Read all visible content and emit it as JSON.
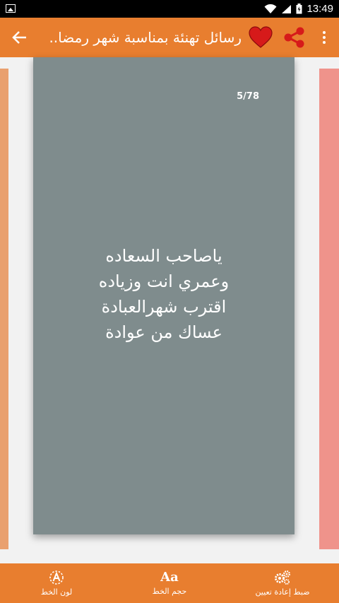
{
  "status_bar": {
    "time": "13:49",
    "icons": [
      "image-icon",
      "wifi-icon",
      "signal-icon",
      "battery-icon"
    ]
  },
  "app_bar": {
    "title": "رسائل تهنئة بمناسبة شهر رمضا...",
    "icons": [
      "more-vert-icon",
      "share-icon",
      "heart-icon",
      "back-arrow-icon"
    ]
  },
  "card": {
    "counter": "5/78",
    "lines": [
      "ياصاحب السعاده",
      "وعمري انت وزياده",
      "اقترب شهرالعبادة",
      "عساك من عوادة"
    ]
  },
  "bottom_bar": {
    "items": [
      {
        "icon": "font-color-icon",
        "label": "لون الخط"
      },
      {
        "icon": "font-size-icon",
        "glyph": "Aa",
        "label": "حجم الخط"
      },
      {
        "icon": "settings-gears-icon",
        "label": "ضبط إعادة تعيين"
      }
    ]
  },
  "colors": {
    "app_bar": "#e87e2f",
    "card": "#7f8c8d",
    "side_left": "#e9a06f",
    "side_right": "#ef938b",
    "heart": "#d61a1a"
  }
}
